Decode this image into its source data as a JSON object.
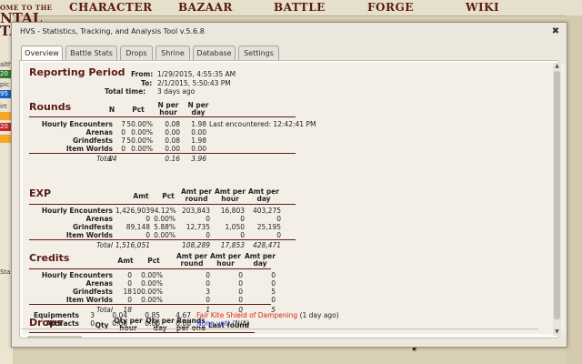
{
  "bg": {
    "nav": [
      "CHARACTER",
      "BAZAAR",
      "BATTLE",
      "FORGE",
      "WIKI"
    ],
    "left_stub": "OME TO THE",
    "big_title": [
      "NTAL",
      "TA"
    ],
    "left_labels": [
      "alth",
      "pic",
      "irt",
      "Stam"
    ],
    "left_values": [
      "20",
      "95",
      "20"
    ],
    "swatch_colors": [
      "#2e7d32",
      "#1565c0",
      "#f9a825",
      "#c62828"
    ]
  },
  "dialog": {
    "title": "HVS - Statistics, Tracking, and Analysis Tool v.5.6.8",
    "tabs": [
      "Overview",
      "Battle Stats",
      "Drops",
      "Shrine",
      "Database",
      "Settings"
    ],
    "active_tab": "Overview"
  },
  "reporting": {
    "title": "Reporting Period",
    "from_label": "From:",
    "from_value": "1/29/2015, 4:55:35 AM",
    "to_label": "To:",
    "to_value": "2/1/2015, 5:50:43 PM",
    "total_label": "Total time:",
    "total_value": "3 days ago"
  },
  "rounds": {
    "title": "Rounds",
    "headers": [
      "N",
      "Pct",
      "N per hour",
      "N per day"
    ],
    "rows": [
      {
        "label": "Hourly Encounters",
        "n": "7",
        "pct": "50.00%",
        "hour": "0.08",
        "day": "1.98",
        "extra": "Last encountered: 12:42:41 PM"
      },
      {
        "label": "Arenas",
        "n": "0",
        "pct": "0.00%",
        "hour": "0.00",
        "day": "0.00",
        "extra": ""
      },
      {
        "label": "Grindfests",
        "n": "7",
        "pct": "50.00%",
        "hour": "0.08",
        "day": "1.98",
        "extra": ""
      },
      {
        "label": "Item Worlds",
        "n": "0",
        "pct": "0.00%",
        "hour": "0.00",
        "day": "0.00",
        "extra": ""
      }
    ],
    "total": {
      "label": "Total",
      "n": "14",
      "hour": "0.16",
      "day": "3.96"
    }
  },
  "exp": {
    "title": "EXP",
    "headers": [
      "Amt",
      "Pct",
      "Amt per round",
      "Amt per hour",
      "Amt per day"
    ],
    "rows": [
      {
        "label": "Hourly Encounters",
        "amt": "1,426,903",
        "pct": "94.12%",
        "round": "203,843",
        "hour": "16,803",
        "day": "403,275"
      },
      {
        "label": "Arenas",
        "amt": "0",
        "pct": "0.00%",
        "round": "0",
        "hour": "0",
        "day": "0"
      },
      {
        "label": "Grindfests",
        "amt": "89,148",
        "pct": "5.88%",
        "round": "12,735",
        "hour": "1,050",
        "day": "25,195"
      },
      {
        "label": "Item Worlds",
        "amt": "0",
        "pct": "0.00%",
        "round": "0",
        "hour": "0",
        "day": "0"
      }
    ],
    "total": {
      "label": "Total",
      "amt": "1,516,051",
      "round": "108,289",
      "hour": "17,853",
      "day": "428,471"
    }
  },
  "credits": {
    "title": "Credits",
    "headers": [
      "Amt",
      "Pct",
      "Amt per round",
      "Amt per hour",
      "Amt per day"
    ],
    "rows": [
      {
        "label": "Hourly Encounters",
        "amt": "0",
        "pct": "0.00%",
        "round": "0",
        "hour": "0",
        "day": "0"
      },
      {
        "label": "Arenas",
        "amt": "0",
        "pct": "0.00%",
        "round": "0",
        "hour": "0",
        "day": "0"
      },
      {
        "label": "Grindfests",
        "amt": "18",
        "pct": "100.00%",
        "round": "3",
        "hour": "0",
        "day": "5"
      },
      {
        "label": "Item Worlds",
        "amt": "0",
        "pct": "0.00%",
        "round": "0",
        "hour": "0",
        "day": "0"
      }
    ],
    "total": {
      "label": "Total",
      "amt": "18",
      "round": "1",
      "hour": "0",
      "day": "5"
    }
  },
  "drops": {
    "title": "Drops",
    "headers": [
      "Qty",
      "Qty per hour",
      "Qty per day",
      "Rounds per one",
      "Last found"
    ],
    "rows": [
      {
        "label": "Equipments",
        "qty": "3",
        "hour": "0.04",
        "day": "0.85",
        "per_one": "4.67",
        "last_item": "Fair Kite Shield of Dampening",
        "last_when": "(1 day ago)",
        "item_color": "#d8261c"
      },
      {
        "label": "Artifacts",
        "qty": "0",
        "hour": "0.00",
        "day": "0.00",
        "per_one": "0.00",
        "last_item": "None yet!",
        "last_when": "(N/A)",
        "item_color": "#2440d8"
      }
    ]
  }
}
